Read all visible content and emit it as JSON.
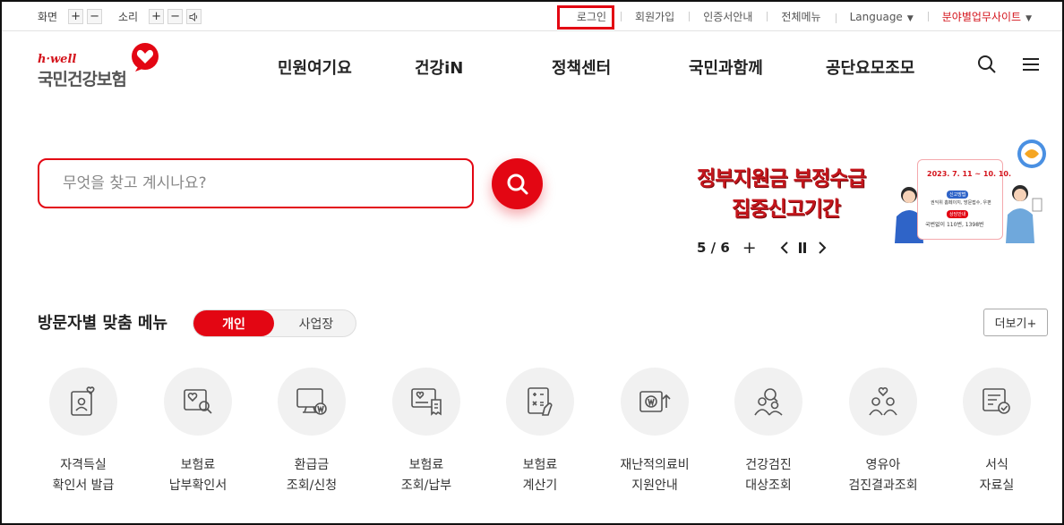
{
  "utility": {
    "screen_label": "화면",
    "sound_label": "소리",
    "plus": "+",
    "minus": "−",
    "links": {
      "login": "로그인",
      "signup": "회원가입",
      "cert": "인증서안내",
      "allmenu": "전체메뉴",
      "language": "Language",
      "business": "분야별업무사이트"
    }
  },
  "logo": {
    "hwell": "h·well",
    "name": "국민건강보험"
  },
  "nav": {
    "items": [
      "민원여기요",
      "건강iN",
      "정책센터",
      "국민과함께",
      "공단요모조모"
    ]
  },
  "search": {
    "placeholder": "무엇을 찾고 계시나요?"
  },
  "banner": {
    "line1": "정부지원금 부정수급",
    "line2": "집중신고기간",
    "date": "2023. 7. 11 ~ 10. 10.",
    "pill1": "신고방법",
    "detail1": "권익위 홈페이지, 방문접수, 우편",
    "pill2": "상담안내",
    "detail2": "국번없이 110번, 1398번",
    "counter": "5 / 6",
    "plus": "+"
  },
  "visitor_menu": {
    "title": "방문자별 맞춤 메뉴",
    "tab_personal": "개인",
    "tab_business": "사업장",
    "more": "더보기+"
  },
  "quick": [
    {
      "icon": "person-card-heart-icon",
      "label": "자격득실\n확인서 발급"
    },
    {
      "icon": "heart-search-icon",
      "label": "보험료\n납부확인서"
    },
    {
      "icon": "monitor-won-icon",
      "label": "환급금\n조회/신청"
    },
    {
      "icon": "monitor-receipt-icon",
      "label": "보험료\n조회/납부"
    },
    {
      "icon": "calculator-hand-icon",
      "label": "보험료\n계산기"
    },
    {
      "icon": "won-card-up-icon",
      "label": "재난적의료비\n지원안내"
    },
    {
      "icon": "people-search-icon",
      "label": "건강검진\n대상조회"
    },
    {
      "icon": "family-heart-icon",
      "label": "영유아\n검진결과조회"
    },
    {
      "icon": "document-check-icon",
      "label": "서식\n자료실"
    }
  ],
  "colors": {
    "accent": "#e30613",
    "logo_red": "#d4141c"
  }
}
